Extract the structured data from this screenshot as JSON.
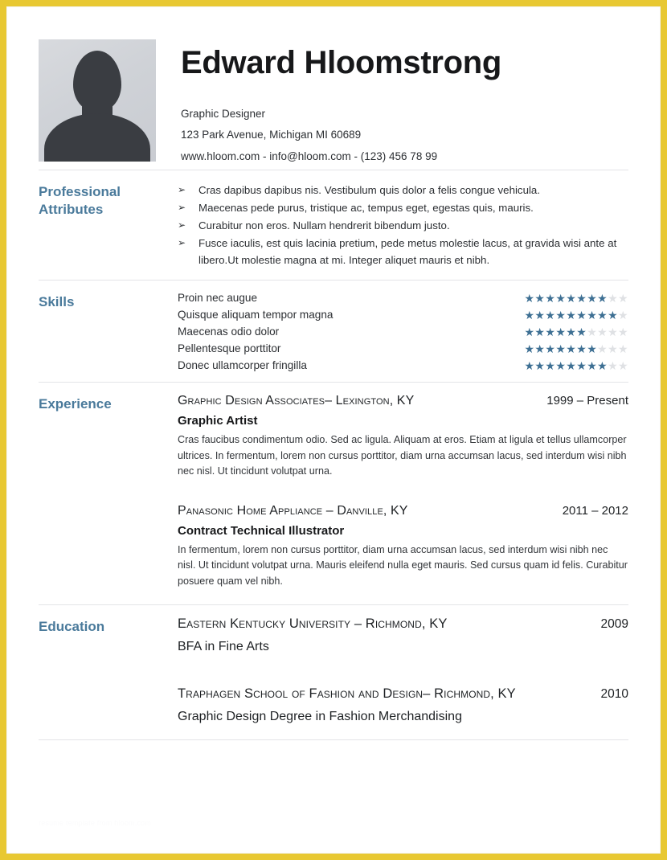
{
  "document": {
    "border_color": "#e8c832",
    "accent_color": "#4a7a9b",
    "star_on_color": "#3d6f93",
    "star_off_color": "#dfe1e4"
  },
  "header": {
    "name": "Edward Hloomstrong",
    "job_title": "Graphic Designer",
    "address": "123 Park Avenue, Michigan MI 60689",
    "contact": "www.hloom.com - info@hloom.com - (123) 456 78 99",
    "photo_alt": "person-silhouette"
  },
  "sections": {
    "attributes": {
      "label": "Professional Attributes",
      "bullet_glyph": "➢",
      "items": [
        "Cras dapibus dapibus nis. Vestibulum quis dolor a felis congue vehicula.",
        "Maecenas pede purus, tristique ac, tempus eget, egestas quis, mauris.",
        "Curabitur non eros. Nullam hendrerit bibendum justo.",
        "Fusce iaculis, est quis lacinia pretium, pede metus molestie lacus, at gravida wisi ante at libero.Ut molestie magna at mi. Integer aliquet mauris et nibh."
      ]
    },
    "skills": {
      "label": "Skills",
      "max_stars": 10,
      "items": [
        {
          "name": "Proin nec augue",
          "rating": 8
        },
        {
          "name": "Quisque aliquam tempor magna",
          "rating": 9
        },
        {
          "name": "Maecenas odio dolor",
          "rating": 6
        },
        {
          "name": "Pellentesque porttitor",
          "rating": 7
        },
        {
          "name": "Donec ullamcorper fringilla",
          "rating": 8
        }
      ]
    },
    "experience": {
      "label": "Experience",
      "entries": [
        {
          "organization": "Graphic Design Associates– Lexington, KY",
          "date": "1999 – Present",
          "role": "Graphic Artist",
          "description": "Cras faucibus condimentum odio. Sed ac ligula. Aliquam at eros. Etiam at ligula et tellus ullamcorper ultrices. In fermentum, lorem non cursus porttitor, diam urna accumsan lacus, sed interdum wisi nibh nec nisl. Ut tincidunt volutpat urna."
        },
        {
          "organization": "Panasonic Home Appliance – Danville, KY",
          "date": "2011 – 2012",
          "role": "Contract Technical Illustrator",
          "description": "In fermentum, lorem non cursus porttitor, diam urna accumsan lacus, sed interdum wisi nibh nec nisl. Ut tincidunt volutpat urna. Mauris eleifend nulla eget mauris. Sed cursus quam id felis. Curabitur posuere quam vel nibh."
        }
      ]
    },
    "education": {
      "label": "Education",
      "entries": [
        {
          "organization": "Eastern Kentucky University – Richmond, KY",
          "date": "2009",
          "degree": "BFA in Fine Arts"
        },
        {
          "organization": "Traphagen School of Fashion and Design– Richmond, KY",
          "date": "2010",
          "degree": "Graphic Design Degree in Fashion Merchandising"
        }
      ]
    }
  },
  "footer": {
    "watermark": "resume template from hloom.com"
  }
}
